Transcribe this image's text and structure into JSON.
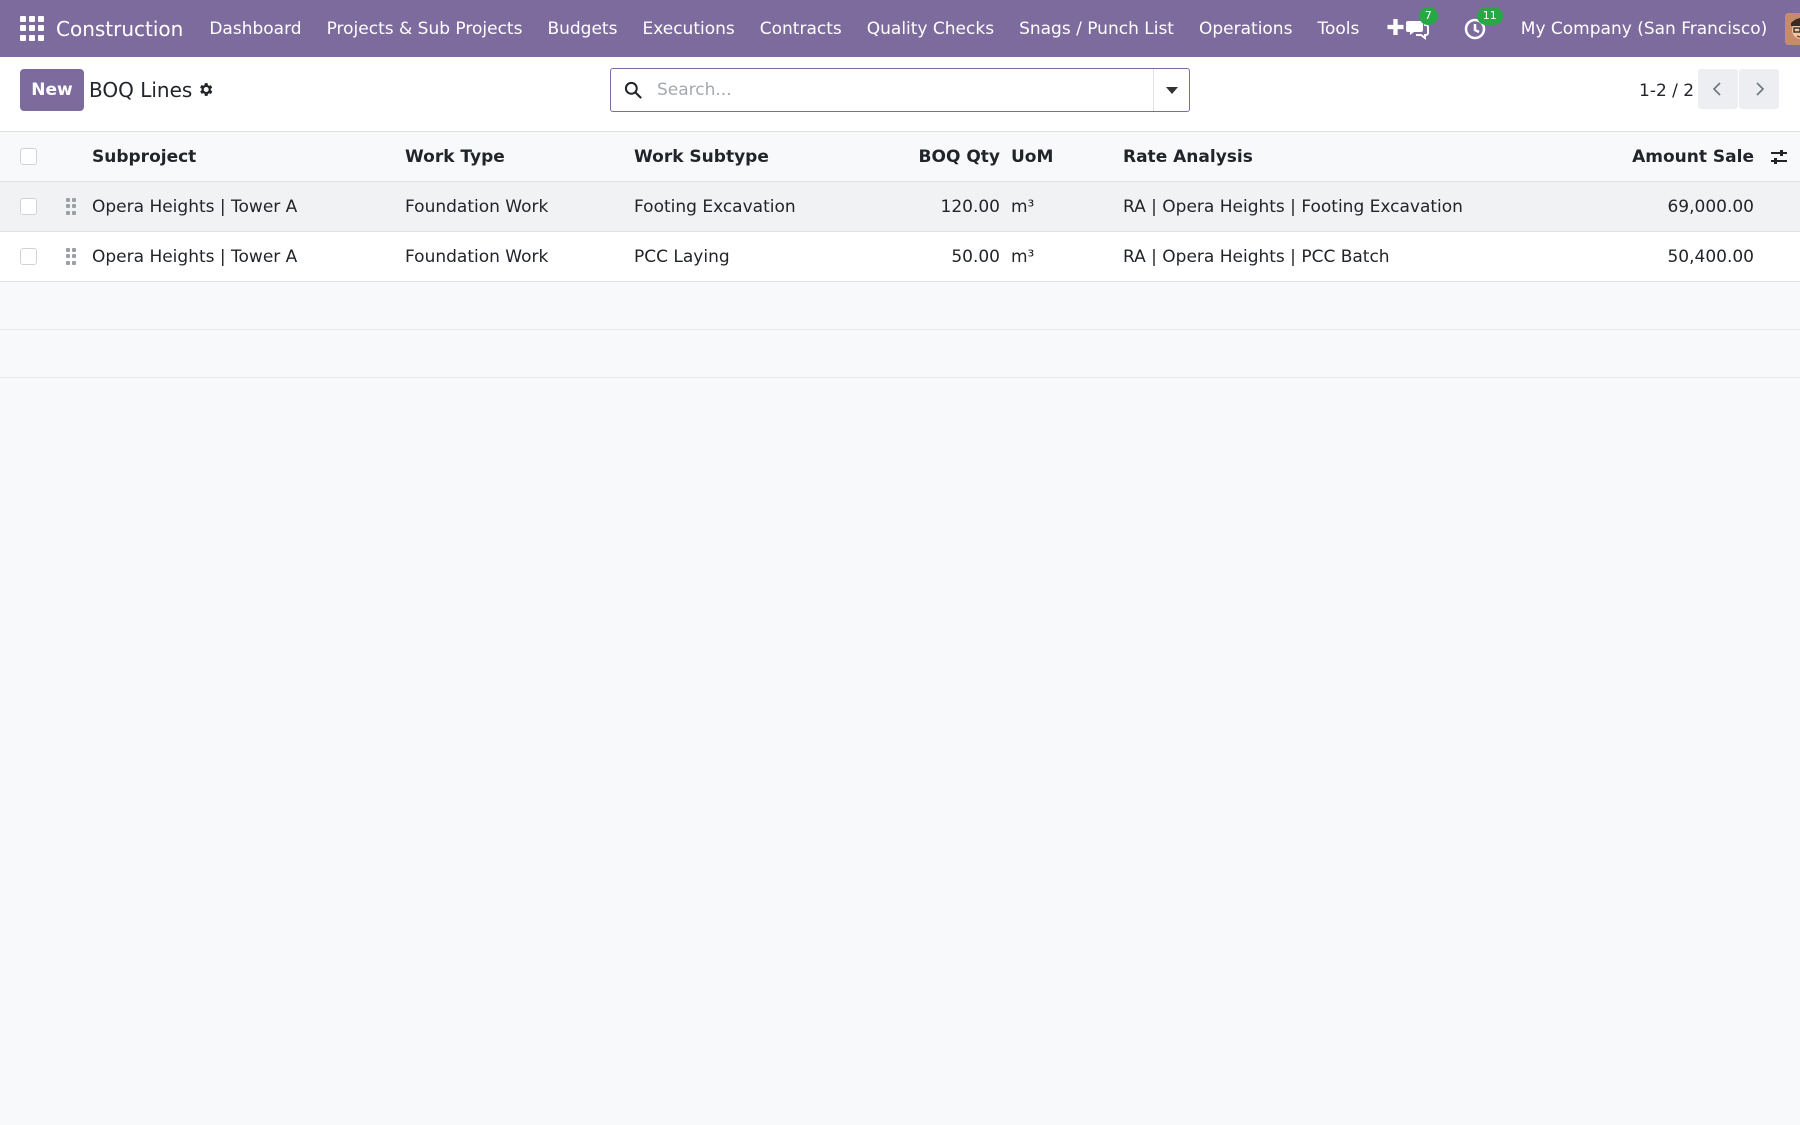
{
  "nav": {
    "brand": "Construction",
    "menu": [
      "Dashboard",
      "Projects & Sub Projects",
      "Budgets",
      "Executions",
      "Contracts",
      "Quality Checks",
      "Snags / Punch List",
      "Operations",
      "Tools"
    ],
    "plus_icon": "plus-icon",
    "messages_badge": "7",
    "activities_badge": "11",
    "company": "My Company (San Francisco)",
    "accent_color": "#7d6b9e"
  },
  "control": {
    "new_label": "New",
    "title": "BOQ Lines",
    "search_placeholder": "Search...",
    "pager": "1-2 / 2"
  },
  "table": {
    "columns": {
      "subproject": "Subproject",
      "work_type": "Work Type",
      "work_subtype": "Work Subtype",
      "boq_qty": "BOQ Qty",
      "uom": "UoM",
      "rate_analysis": "Rate Analysis",
      "amount_sale": "Amount Sale"
    },
    "rows": [
      {
        "subproject": "Opera Heights | Tower A",
        "work_type": "Foundation Work",
        "work_subtype": "Footing Excavation",
        "boq_qty": "120.00",
        "uom": "m³",
        "rate_analysis": "RA | Opera Heights | Footing Excavation",
        "amount_sale": "69,000.00"
      },
      {
        "subproject": "Opera Heights | Tower A",
        "work_type": "Foundation Work",
        "work_subtype": "PCC Laying",
        "boq_qty": "50.00",
        "uom": "m³",
        "rate_analysis": "RA | Opera Heights | PCC Batch",
        "amount_sale": "50,400.00"
      }
    ]
  }
}
